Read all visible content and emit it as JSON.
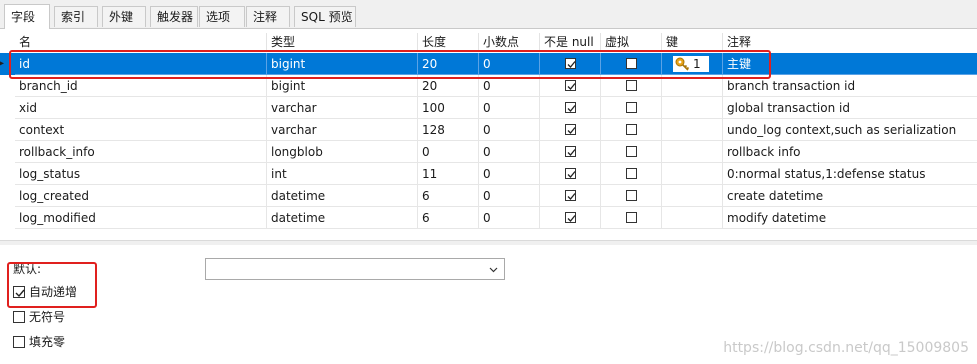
{
  "tabs": [
    "字段",
    "索引",
    "外键",
    "触发器",
    "选项",
    "注释",
    "SQL 预览"
  ],
  "columns": [
    "名",
    "类型",
    "长度",
    "小数点",
    "不是 null",
    "虚拟",
    "键",
    "注释"
  ],
  "rows": [
    {
      "name": "id",
      "type": "bigint",
      "length": "20",
      "decimal": "0",
      "not_null": true,
      "virtual": false,
      "key": "1",
      "comment": "主键",
      "selected": true
    },
    {
      "name": "branch_id",
      "type": "bigint",
      "length": "20",
      "decimal": "0",
      "not_null": true,
      "virtual": false,
      "key": "",
      "comment": "branch transaction id",
      "selected": false
    },
    {
      "name": "xid",
      "type": "varchar",
      "length": "100",
      "decimal": "0",
      "not_null": true,
      "virtual": false,
      "key": "",
      "comment": "global transaction id",
      "selected": false
    },
    {
      "name": "context",
      "type": "varchar",
      "length": "128",
      "decimal": "0",
      "not_null": true,
      "virtual": false,
      "key": "",
      "comment": "undo_log context,such as serialization",
      "selected": false
    },
    {
      "name": "rollback_info",
      "type": "longblob",
      "length": "0",
      "decimal": "0",
      "not_null": true,
      "virtual": false,
      "key": "",
      "comment": "rollback info",
      "selected": false
    },
    {
      "name": "log_status",
      "type": "int",
      "length": "11",
      "decimal": "0",
      "not_null": true,
      "virtual": false,
      "key": "",
      "comment": "0:normal status,1:defense status",
      "selected": false
    },
    {
      "name": "log_created",
      "type": "datetime",
      "length": "6",
      "decimal": "0",
      "not_null": true,
      "virtual": false,
      "key": "",
      "comment": "create datetime",
      "selected": false
    },
    {
      "name": "log_modified",
      "type": "datetime",
      "length": "6",
      "decimal": "0",
      "not_null": true,
      "virtual": false,
      "key": "",
      "comment": "modify datetime",
      "selected": false
    }
  ],
  "props": {
    "default_label": "默认:",
    "default_value": "",
    "auto_increment_label": "自动递增",
    "auto_increment": true,
    "unsigned_label": "无符号",
    "unsigned": false,
    "zerofill_label": "填充零",
    "zerofill": false
  },
  "watermark": "https://blog.csdn.net/qq_15009805",
  "colors": {
    "selection": "#0078d7",
    "annotation": "#e0201e",
    "key_icon": "#e8a317"
  }
}
